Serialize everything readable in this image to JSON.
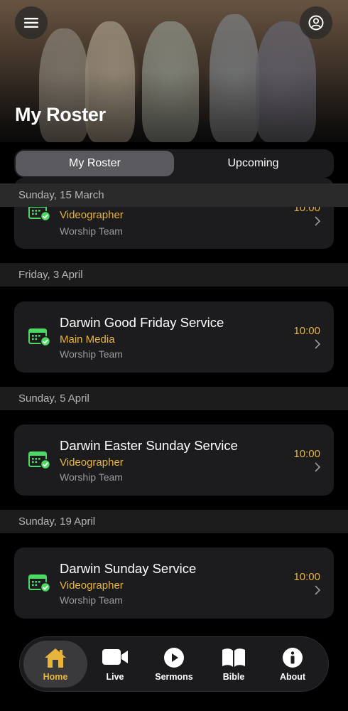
{
  "header": {
    "title": "My Roster",
    "menu_icon": "hamburger-menu-icon",
    "profile_icon": "user-circle-icon"
  },
  "segment": {
    "tabs": [
      {
        "label": "My Roster",
        "active": true
      },
      {
        "label": "Upcoming",
        "active": false
      }
    ]
  },
  "colors": {
    "accent": "#e8b43a",
    "calendar_icon": "#4cd964",
    "card_bg": "#1c1c1e"
  },
  "roster": [
    {
      "date": "Sunday, 15 March",
      "event": {
        "title": "",
        "role": "Videographer",
        "team": "Worship Team",
        "time": "10:00"
      }
    },
    {
      "date": "Friday, 3 April",
      "event": {
        "title": "Darwin Good Friday Service",
        "role": "Main Media",
        "team": "Worship Team",
        "time": "10:00"
      }
    },
    {
      "date": "Sunday, 5 April",
      "event": {
        "title": "Darwin Easter Sunday Service",
        "role": "Videographer",
        "team": "Worship Team",
        "time": "10:00"
      }
    },
    {
      "date": "Sunday, 19 April",
      "event": {
        "title": "Darwin Sunday Service",
        "role": "Videographer",
        "team": "Worship Team",
        "time": "10:00"
      }
    }
  ],
  "tabbar": {
    "items": [
      {
        "label": "Home",
        "icon": "home-icon",
        "active": true
      },
      {
        "label": "Live",
        "icon": "video-camera-icon",
        "active": false
      },
      {
        "label": "Sermons",
        "icon": "play-circle-icon",
        "active": false
      },
      {
        "label": "Bible",
        "icon": "book-icon",
        "active": false
      },
      {
        "label": "About",
        "icon": "info-circle-icon",
        "active": false
      }
    ]
  }
}
